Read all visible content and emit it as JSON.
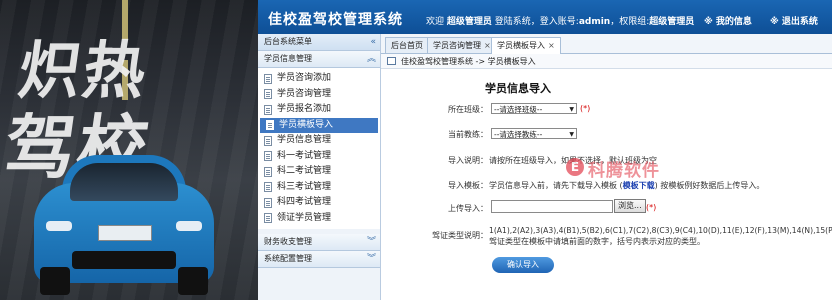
{
  "hero": {
    "words": [
      "炽热",
      "驾校"
    ]
  },
  "header": {
    "title": "佳校盈驾校管理系统",
    "welcome_prefix": "欢迎",
    "username": "超级管理员",
    "login_text": "登陆系统，登入账号:",
    "account": "admin",
    "role_text": "，权限组:",
    "role": "超级管理员",
    "my_info": "※ 我的信息",
    "logout": "※ 退出系统"
  },
  "sidebar": {
    "menu_title": "后台系统菜单",
    "group1": "学员信息管理",
    "items": [
      "学员咨询添加",
      "学员咨询管理",
      "学员报名添加",
      "学员横板导入",
      "学员信息管理",
      "科一考试管理",
      "科二考试管理",
      "科三考试管理",
      "科四考试管理",
      "领证学员管理"
    ],
    "group2": "财务收支管理",
    "group3": "系统配置管理"
  },
  "tabs": [
    {
      "label": "后台首页",
      "closable": false
    },
    {
      "label": "学员咨询管理",
      "closable": true
    },
    {
      "label": "学员横板导入",
      "closable": true
    }
  ],
  "breadcrumb": "佳校盈驾校管理系统 -> 学员横板导入",
  "form": {
    "title": "学员信息导入",
    "class_label": "所在班级：",
    "class_value": "--请选择班级--",
    "coach_label": "当前教练：",
    "coach_value": "--请选择教练--",
    "required_mark": "(*)",
    "note_label": "导入说明：",
    "note_text": "请按所在班级导入，如果不选择，默认班级为空",
    "template_label": "导入模板：",
    "template_text_before": "学员信息导入前，请先下载导入模板 (",
    "template_link": "模板下载",
    "template_text_after": ") 按模板例好数据后上传导入。",
    "upload_label": "上传导入：",
    "browse": "浏览...",
    "license_label": "驾证类型说明：",
    "license_line1": "1(A1),2(A2),3(A3),4(B1),5(B2),6(C1),7(C2),8(C3),9(C4),10(D),11(E),12(F),13(M),14(N),15(P),",
    "license_line2": "驾证类型在模板中请填前面的数字，括号内表示对应的类型。",
    "submit": "确认导入"
  },
  "watermark": "科腾软件"
}
